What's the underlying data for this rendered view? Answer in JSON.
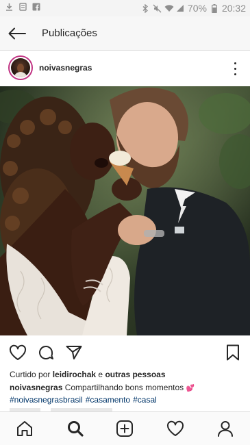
{
  "status_bar": {
    "left_icons": [
      "download-icon",
      "note-icon",
      "facebook-icon"
    ],
    "right_icons": [
      "bluetooth-icon",
      "mute-icon",
      "wifi-icon",
      "signal-icon",
      "battery-icon"
    ],
    "battery": "70%",
    "time": "20:32"
  },
  "header": {
    "title": "Publicações"
  },
  "post": {
    "username": "noivasnegras",
    "likes_prefix": "Curtido por",
    "liked_by_user": "leidirochak",
    "likes_conjunction": "e",
    "likes_others": "outras pessoas",
    "caption_user": "noivasnegras",
    "caption_text": "Compartilhando bons momentos",
    "caption_emoji": "💕",
    "hashtags": [
      "#noivasnegrasbrasil",
      "#casamento",
      "#casal"
    ]
  },
  "colors": {
    "link": "#003569",
    "avatar_ring": "#c13584",
    "text": "#262626"
  }
}
